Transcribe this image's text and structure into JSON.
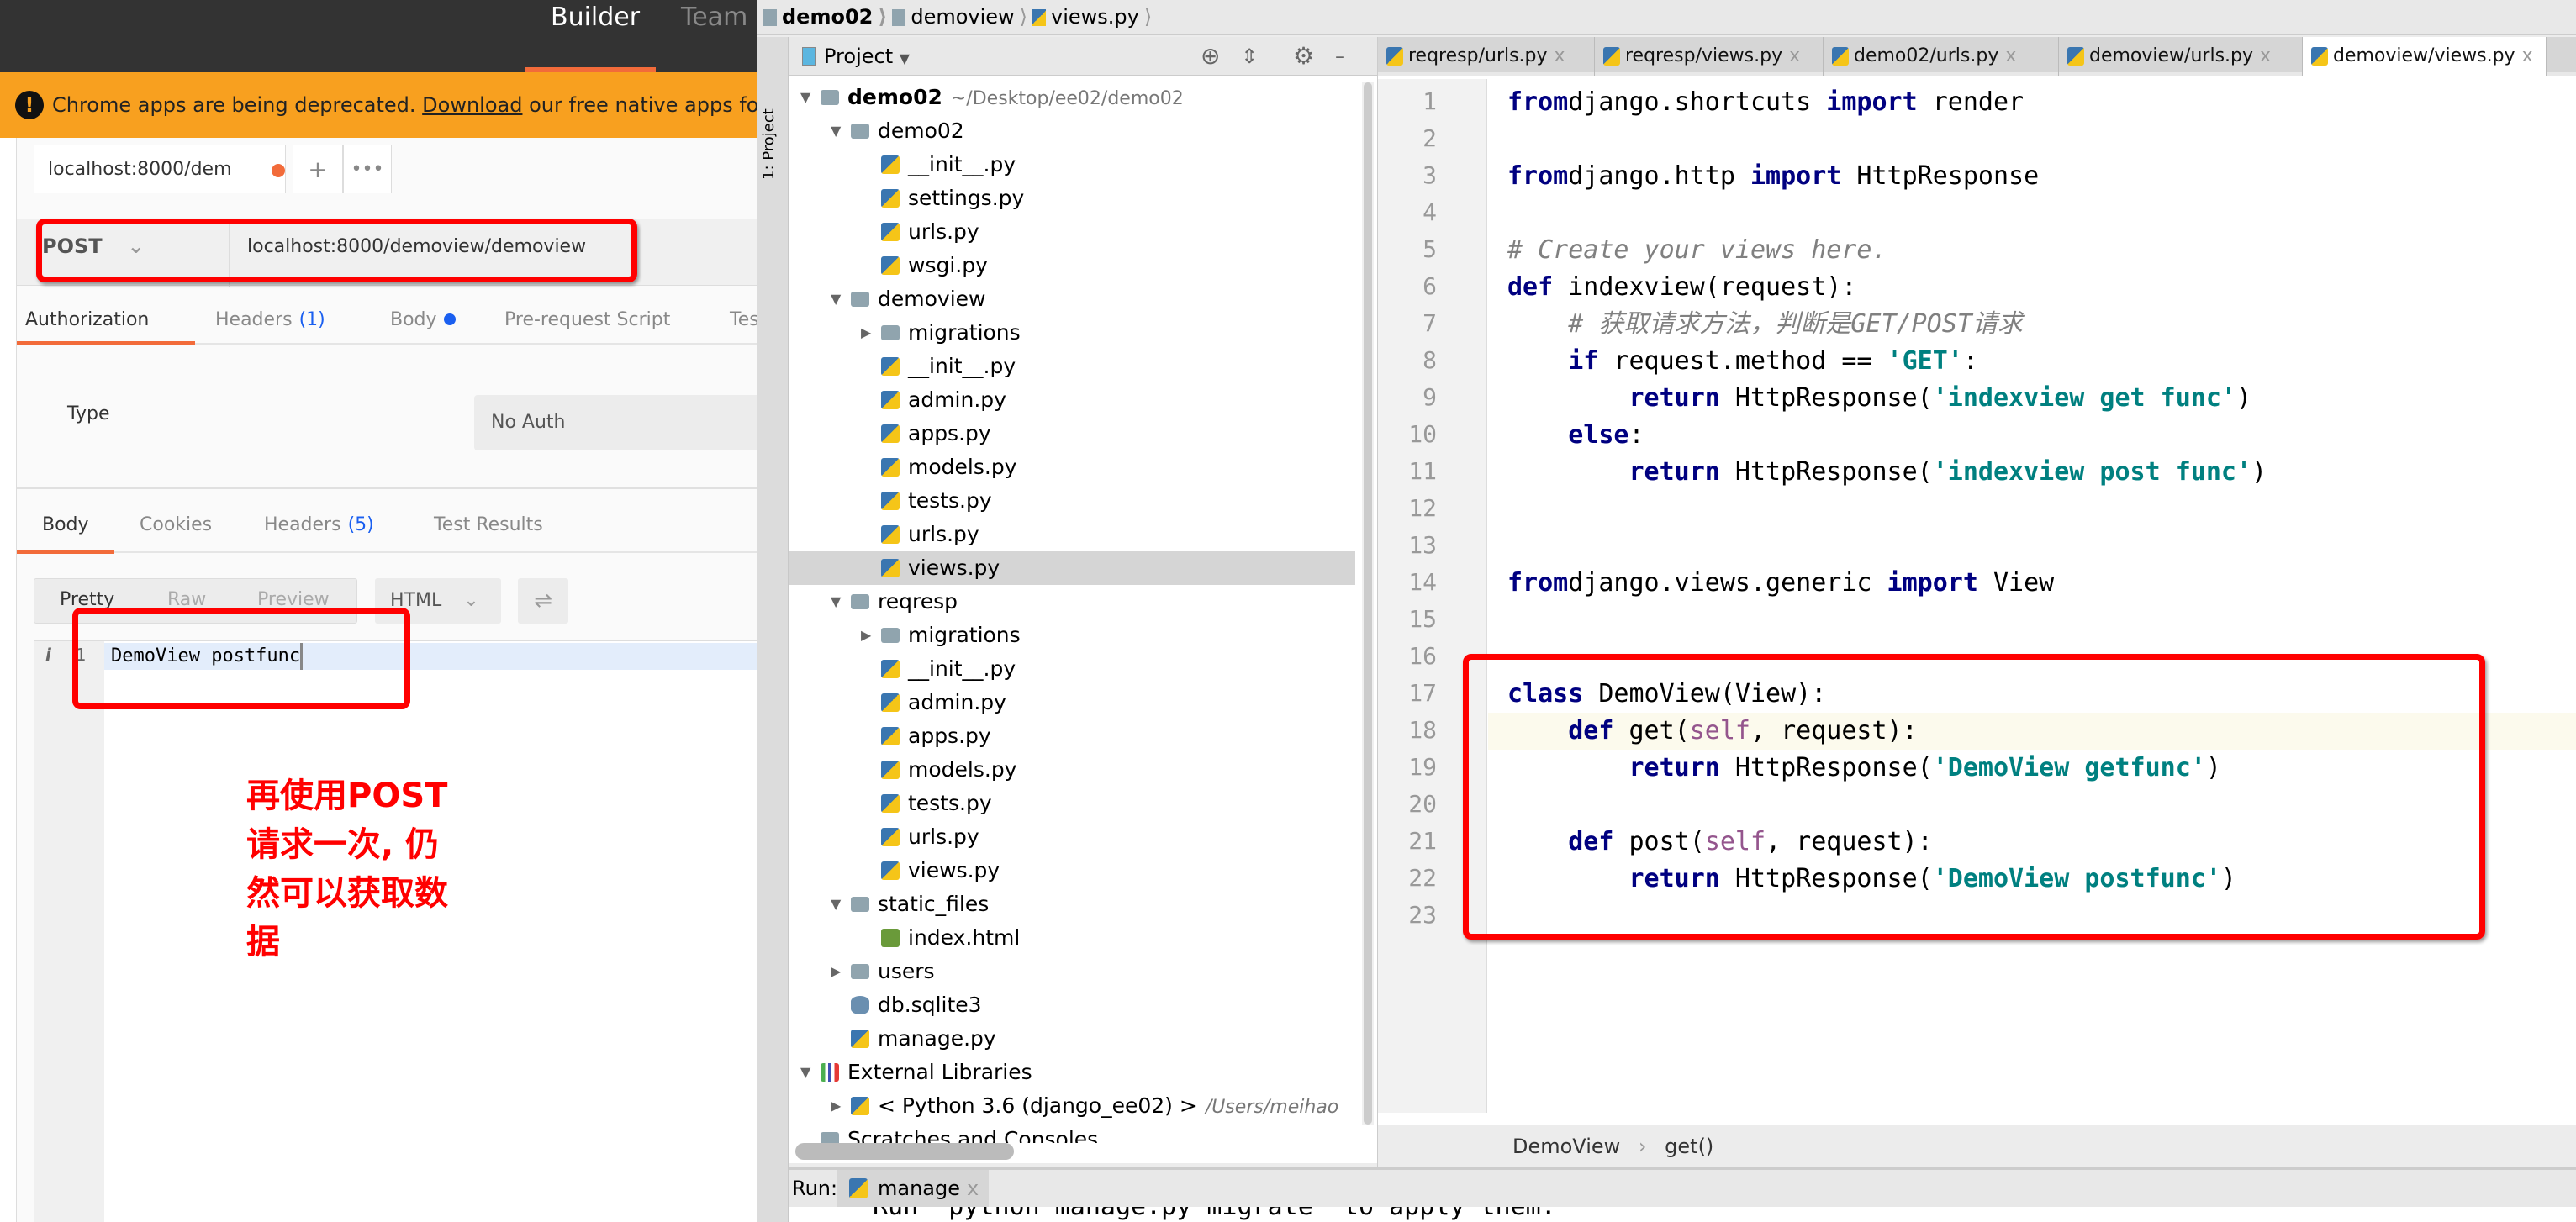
{
  "postman": {
    "top_tabs": [
      "Builder",
      "Team Library"
    ],
    "banner": {
      "text": "Chrome apps are being deprecated. ",
      "link": "Download",
      "rest": " our free native apps for"
    },
    "request_tab": {
      "label": "localhost:8000/dem",
      "unsaved_dot_color": "#f26b3a"
    },
    "new_tab_label": "+",
    "more_label": "•••",
    "method": "POST",
    "url": "localhost:8000/demoview/demoview",
    "request_tabs": [
      {
        "label": "Authorization",
        "active": true
      },
      {
        "label": "Headers",
        "count": "(1)"
      },
      {
        "label": "Body",
        "dot_color": "#1a5ff0"
      },
      {
        "label": "Pre-request Script"
      },
      {
        "label": "Tests"
      }
    ],
    "auth_type_label": "Type",
    "auth_type_value": "No Auth",
    "response_tabs": [
      {
        "label": "Body",
        "active": true
      },
      {
        "label": "Cookies"
      },
      {
        "label": "Headers",
        "count": "(5)"
      },
      {
        "label": "Test Results"
      }
    ],
    "view_modes": [
      "Pretty",
      "Raw",
      "Preview"
    ],
    "format": "HTML",
    "response_line_number": "1",
    "response_body": "DemoView postfunc",
    "annotation": [
      "再使用POST",
      "请求一次, 仍",
      "然可以获取数",
      "据"
    ],
    "annotation_color": "#ff0000"
  },
  "ide": {
    "breadcrumb": [
      "demo02",
      "demoview",
      "views.py"
    ],
    "side_strip_label": "1: Project",
    "project_header": "Project",
    "tree": [
      {
        "label": "demo02",
        "hint": "~/Desktop/ee02/demo02",
        "level": 0,
        "icon": "folder",
        "arrow": "open",
        "bold": true
      },
      {
        "label": "demo02",
        "level": 1,
        "icon": "folder",
        "arrow": "open"
      },
      {
        "label": "__init__.py",
        "level": 2,
        "icon": "py"
      },
      {
        "label": "settings.py",
        "level": 2,
        "icon": "py"
      },
      {
        "label": "urls.py",
        "level": 2,
        "icon": "py"
      },
      {
        "label": "wsgi.py",
        "level": 2,
        "icon": "py"
      },
      {
        "label": "demoview",
        "level": 1,
        "icon": "folder",
        "arrow": "open"
      },
      {
        "label": "migrations",
        "level": 2,
        "icon": "folder",
        "arrow": "closed"
      },
      {
        "label": "__init__.py",
        "level": 2,
        "icon": "py"
      },
      {
        "label": "admin.py",
        "level": 2,
        "icon": "py"
      },
      {
        "label": "apps.py",
        "level": 2,
        "icon": "py"
      },
      {
        "label": "models.py",
        "level": 2,
        "icon": "py"
      },
      {
        "label": "tests.py",
        "level": 2,
        "icon": "py"
      },
      {
        "label": "urls.py",
        "level": 2,
        "icon": "py"
      },
      {
        "label": "views.py",
        "level": 2,
        "icon": "py",
        "selected": true
      },
      {
        "label": "reqresp",
        "level": 1,
        "icon": "folder",
        "arrow": "open"
      },
      {
        "label": "migrations",
        "level": 2,
        "icon": "folder",
        "arrow": "closed"
      },
      {
        "label": "__init__.py",
        "level": 2,
        "icon": "py"
      },
      {
        "label": "admin.py",
        "level": 2,
        "icon": "py"
      },
      {
        "label": "apps.py",
        "level": 2,
        "icon": "py"
      },
      {
        "label": "models.py",
        "level": 2,
        "icon": "py"
      },
      {
        "label": "tests.py",
        "level": 2,
        "icon": "py"
      },
      {
        "label": "urls.py",
        "level": 2,
        "icon": "py"
      },
      {
        "label": "views.py",
        "level": 2,
        "icon": "py"
      },
      {
        "label": "static_files",
        "level": 1,
        "icon": "folder",
        "arrow": "open"
      },
      {
        "label": "index.html",
        "level": 2,
        "icon": "html"
      },
      {
        "label": "users",
        "level": 1,
        "icon": "folder",
        "arrow": "closed"
      },
      {
        "label": "db.sqlite3",
        "level": 1,
        "icon": "db"
      },
      {
        "label": "manage.py",
        "level": 1,
        "icon": "py"
      },
      {
        "label": "External Libraries",
        "level": 0,
        "icon": "lib",
        "arrow": "open"
      },
      {
        "label": "< Python 3.6 (django_ee02) >",
        "hint": "/Users/meihao",
        "level": 1,
        "icon": "py",
        "arrow": "closed"
      },
      {
        "label": "Scratches and Consoles",
        "level": 0,
        "icon": "folder"
      }
    ],
    "editor_tabs": [
      {
        "label": "reqresp/urls.py"
      },
      {
        "label": "reqresp/views.py"
      },
      {
        "label": "demo02/urls.py"
      },
      {
        "label": "demoview/urls.py"
      },
      {
        "label": "demoview/views.py",
        "active": true
      }
    ],
    "tab_close": "x",
    "current_line": 18,
    "code": [
      [
        [
          "k",
          "from"
        ],
        [
          "",
          "django.shortcuts "
        ],
        [
          "k",
          "import"
        ],
        [
          "",
          " render"
        ]
      ],
      [],
      [
        [
          "k",
          "from"
        ],
        [
          "",
          "django.http "
        ],
        [
          "k",
          "import"
        ],
        [
          "",
          " HttpResponse"
        ]
      ],
      [],
      [
        [
          "c",
          "# Create your views here."
        ]
      ],
      [
        [
          "k",
          "def"
        ],
        [
          "",
          " indexview(request):"
        ]
      ],
      [
        [
          "",
          "    "
        ],
        [
          "c",
          "# 获取请求方法，判断是GET/POST请求"
        ]
      ],
      [
        [
          "",
          "    "
        ],
        [
          "k",
          "if"
        ],
        [
          "",
          " request.method == "
        ],
        [
          "s",
          "'GET'"
        ],
        [
          "",
          ":"
        ]
      ],
      [
        [
          "",
          "        "
        ],
        [
          "k",
          "return"
        ],
        [
          "",
          " HttpResponse("
        ],
        [
          "s",
          "'indexview get func'"
        ],
        [
          "",
          ")"
        ]
      ],
      [
        [
          "",
          "    "
        ],
        [
          "k",
          "else"
        ],
        [
          "",
          ":"
        ]
      ],
      [
        [
          "",
          "        "
        ],
        [
          "k",
          "return"
        ],
        [
          "",
          " HttpResponse("
        ],
        [
          "s",
          "'indexview post func'"
        ],
        [
          "",
          ")"
        ]
      ],
      [],
      [],
      [
        [
          "k",
          "from"
        ],
        [
          "",
          "django.views.generic "
        ],
        [
          "k",
          "import"
        ],
        [
          "",
          " View"
        ]
      ],
      [],
      [],
      [
        [
          "k",
          "class"
        ],
        [
          "",
          " DemoView(View):"
        ]
      ],
      [
        [
          "",
          "    "
        ],
        [
          "k",
          "def"
        ],
        [
          "",
          " get("
        ],
        [
          "sf",
          "self"
        ],
        [
          "",
          ", request):"
        ]
      ],
      [
        [
          "",
          "        "
        ],
        [
          "k",
          "return"
        ],
        [
          "",
          " HttpResponse("
        ],
        [
          "s",
          "'DemoView getfunc'"
        ],
        [
          "",
          ")"
        ]
      ],
      [],
      [
        [
          "",
          "    "
        ],
        [
          "k",
          "def"
        ],
        [
          "",
          " post("
        ],
        [
          "sf",
          "self"
        ],
        [
          "",
          ", request):"
        ]
      ],
      [
        [
          "",
          "        "
        ],
        [
          "k",
          "return"
        ],
        [
          "",
          " HttpResponse("
        ],
        [
          "s",
          "'DemoView postfunc'"
        ],
        [
          "",
          ")"
        ]
      ],
      []
    ],
    "editor_breadcrumb": [
      "DemoView",
      "get()"
    ],
    "run_label": "Run:",
    "run_tab": "manage",
    "console_text": "Run 'python manage.py migrate' to apply them."
  }
}
